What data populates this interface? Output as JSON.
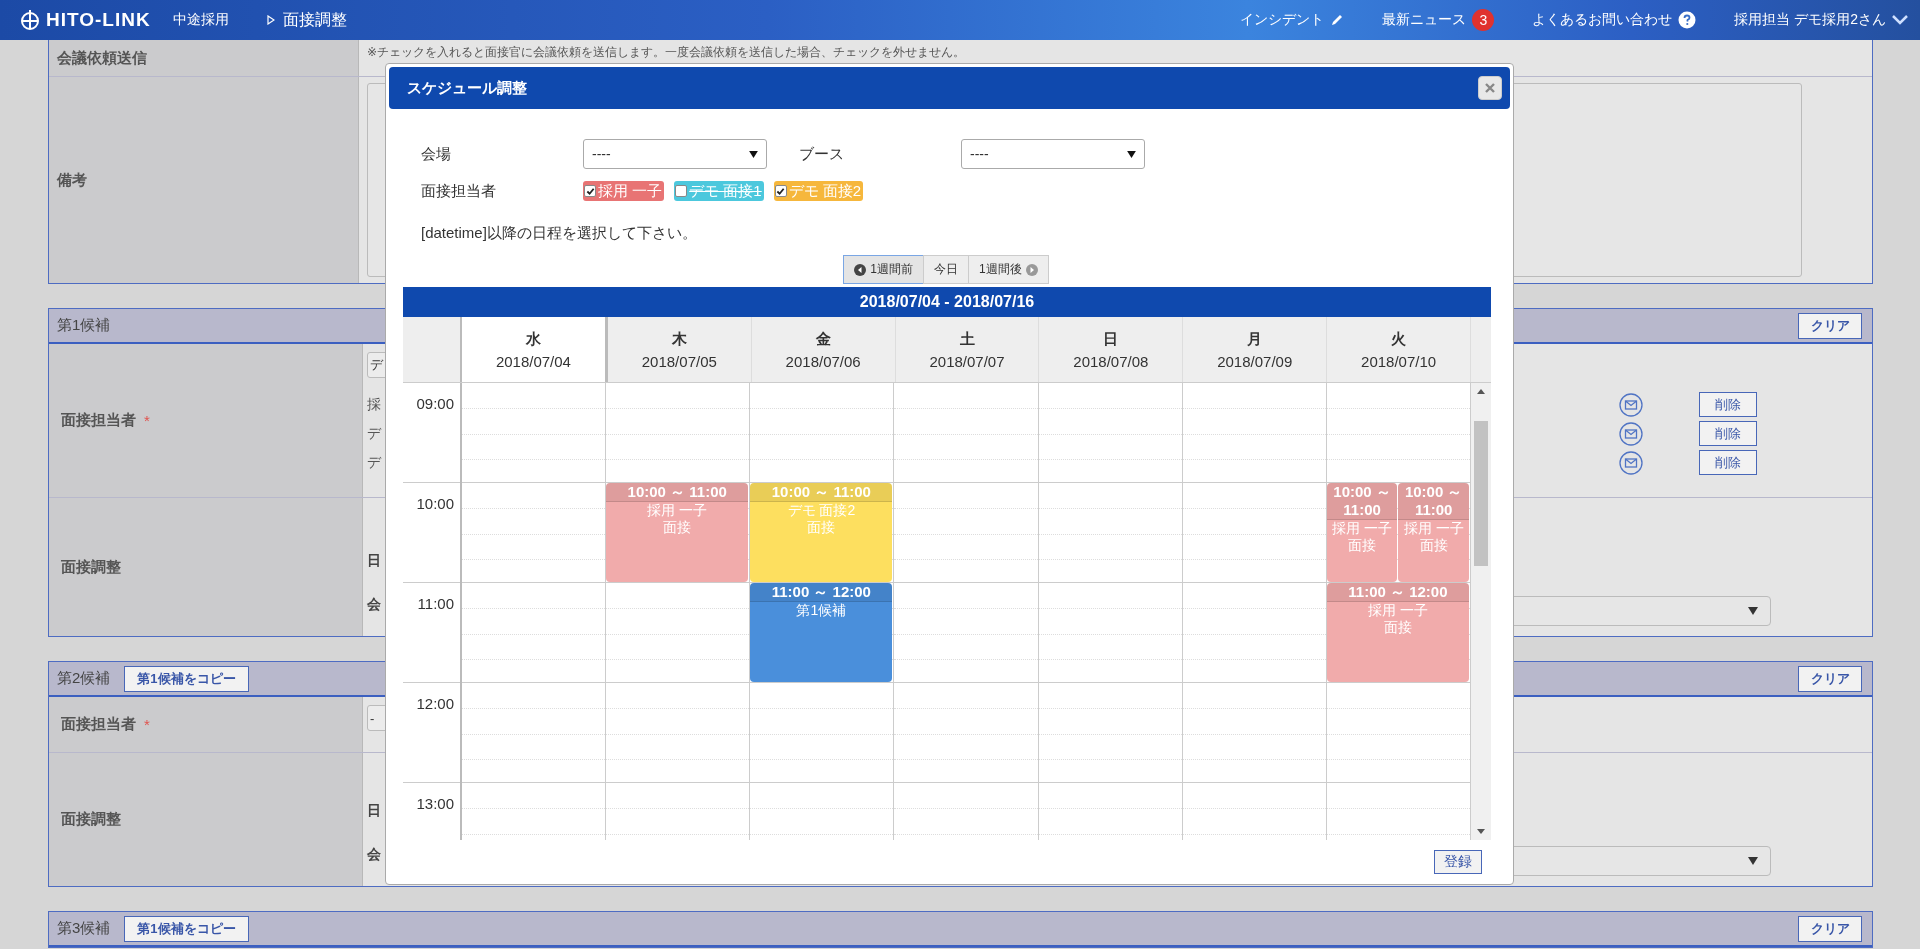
{
  "header": {
    "logo": "HITO-LINK",
    "breadcrumb": [
      {
        "label": "中途採用",
        "kind": "plain"
      },
      {
        "label": "面接調整",
        "kind": "arrow"
      }
    ],
    "nav": [
      {
        "label": "インシデント",
        "kind": "pencil"
      },
      {
        "label": "最新ニュース",
        "kind": "badge",
        "badge": "3"
      },
      {
        "label": "よくあるお問い合わせ",
        "kind": "help"
      },
      {
        "label": "採用担当 デモ採用2さん",
        "kind": "user"
      }
    ]
  },
  "meeting_section": {
    "request_label": "会議依頼送信",
    "note": "※チェックを入れると面接官に会議依頼を送信します。一度会議依頼を送信した場合、チェックを外せません。",
    "remarks_label": "備考"
  },
  "candidates": [
    {
      "title": "第1候補",
      "clear_button": "クリア",
      "interviewer_label": "面接担当者",
      "required_mark": "*",
      "interviewer_select": "デ",
      "interviewers": [
        {
          "name": "採",
          "delete_button": "削除"
        },
        {
          "name": "デ",
          "delete_button": "削除"
        },
        {
          "name": "デ",
          "delete_button": "削除"
        }
      ],
      "schedule_label": "面接調整",
      "date_label": "日",
      "venue_label": "会"
    },
    {
      "title": "第2候補",
      "copy_button": "第1候補をコピー",
      "clear_button": "クリア",
      "interviewer_label": "面接担当者",
      "required_mark": "*",
      "interviewer_select": "-",
      "schedule_label": "面接調整",
      "date_label": "日",
      "venue_label": "会"
    },
    {
      "title": "第3候補",
      "copy_button": "第1候補をコピー",
      "clear_button": "クリア"
    }
  ],
  "modal": {
    "title": "スケジュール調整",
    "venue_label": "会場",
    "venue_value": "----",
    "booth_label": "ブース",
    "booth_value": "----",
    "interviewer_label": "面接担当者",
    "interviewers": [
      {
        "name": "採用 一子",
        "checked": true,
        "color": "#e87474"
      },
      {
        "name": "デモ 面接1",
        "checked": false,
        "color": "#4cc8dd"
      },
      {
        "name": "デモ 面接2",
        "checked": true,
        "color": "#f6b73c"
      }
    ],
    "instruction": "[datetime]以降の日程を選択して下さい。",
    "nav_buttons": [
      {
        "label": "1週間前",
        "kind": "prev",
        "selected": true
      },
      {
        "label": "今日",
        "kind": "today",
        "selected": false
      },
      {
        "label": "1週間後",
        "kind": "next",
        "selected": false
      }
    ],
    "range": "2018/07/04 - 2018/07/16",
    "hours": [
      "09:00",
      "10:00",
      "11:00",
      "12:00",
      "13:00"
    ],
    "days": [
      {
        "weekday": "水",
        "date": "2018/07/04",
        "selected": true
      },
      {
        "weekday": "木",
        "date": "2018/07/05",
        "selected": false,
        "events": [
          {
            "time": "10:00 ～ 11:00",
            "lines": [
              "採用 一子",
              "面接"
            ],
            "color": "#f1abab"
          }
        ]
      },
      {
        "weekday": "金",
        "date": "2018/07/06",
        "selected": false,
        "events": [
          {
            "time": "10:00 ～ 11:00",
            "lines": [
              "デモ 面接2",
              "面接"
            ],
            "color": "#fddf5f"
          },
          {
            "time": "11:00 ～ 12:00",
            "lines": [
              "第1候補"
            ],
            "color": "#4a8fdb"
          }
        ]
      },
      {
        "weekday": "土",
        "date": "2018/07/07",
        "selected": false
      },
      {
        "weekday": "日",
        "date": "2018/07/08",
        "selected": false
      },
      {
        "weekday": "月",
        "date": "2018/07/09",
        "selected": false
      },
      {
        "weekday": "火",
        "date": "2018/07/10",
        "selected": false,
        "events": [
          {
            "time": "10:00 ～ 11:00",
            "lines": [
              "採用 一子",
              "面接"
            ],
            "color": "#f1abab"
          },
          {
            "time": "10:00 ～ 11:00",
            "lines": [
              "採用 一子",
              "面接"
            ],
            "color": "#f1abab"
          },
          {
            "time": "11:00 ～ 12:00",
            "lines": [
              "採用 一子",
              "面接"
            ],
            "color": "#f1abab"
          }
        ]
      }
    ],
    "submit_button": "登録"
  }
}
